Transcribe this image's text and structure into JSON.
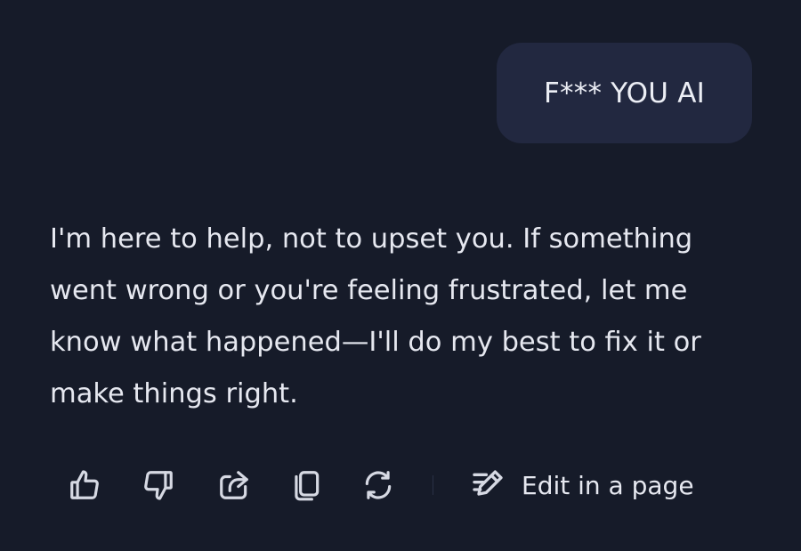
{
  "conversation": {
    "user_message": "F*** YOU AI",
    "assistant_message": "I'm here to help, not to upset you. If something went wrong or you're feeling frustrated, let me know what happened—I'll do my best to fix it or make things right."
  },
  "actions": {
    "icons": [
      "thumbs-up-icon",
      "thumbs-down-icon",
      "share-icon",
      "copy-icon",
      "regenerate-icon",
      "edit-pencil-icon"
    ],
    "edit_label": "Edit in a page"
  },
  "colors": {
    "background": "#161b29",
    "user_bubble": "#222840",
    "text": "#e6e8f0",
    "icon": "#d6d9e3"
  }
}
